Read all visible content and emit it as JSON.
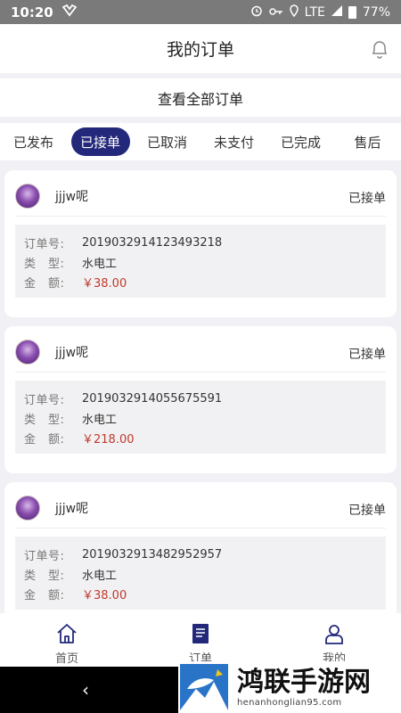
{
  "status_bar": {
    "time": "10:20",
    "network": "LTE",
    "battery": "77%"
  },
  "header": {
    "title": "我的订单"
  },
  "view_all": "查看全部订单",
  "tabs": [
    {
      "label": "已发布",
      "active": false
    },
    {
      "label": "已接单",
      "active": true
    },
    {
      "label": "已取消",
      "active": false
    },
    {
      "label": "未支付",
      "active": false
    },
    {
      "label": "已完成",
      "active": false
    },
    {
      "label": "售后",
      "active": false
    }
  ],
  "field_labels": {
    "order_no": "订单号:",
    "type": "类　型:",
    "amount": "金　额:"
  },
  "orders": [
    {
      "user": "jjjw呢",
      "status": "已接单",
      "order_no": "2019032914123493218",
      "type": "水电工",
      "amount": "￥38.00"
    },
    {
      "user": "jjjw呢",
      "status": "已接单",
      "order_no": "2019032914055675591",
      "type": "水电工",
      "amount": "￥218.00"
    },
    {
      "user": "jjjw呢",
      "status": "已接单",
      "order_no": "2019032913482952957",
      "type": "水电工",
      "amount": "￥38.00"
    }
  ],
  "bottom_nav": [
    {
      "label": "首页",
      "icon": "home-icon"
    },
    {
      "label": "订单",
      "icon": "order-icon"
    },
    {
      "label": "我的",
      "icon": "user-icon"
    }
  ],
  "watermark": {
    "text": "鸿联手游网",
    "url": "henanhonglian95.com"
  },
  "colors": {
    "accent": "#23287a",
    "money": "#c0392b",
    "background": "#f1f1f5"
  }
}
